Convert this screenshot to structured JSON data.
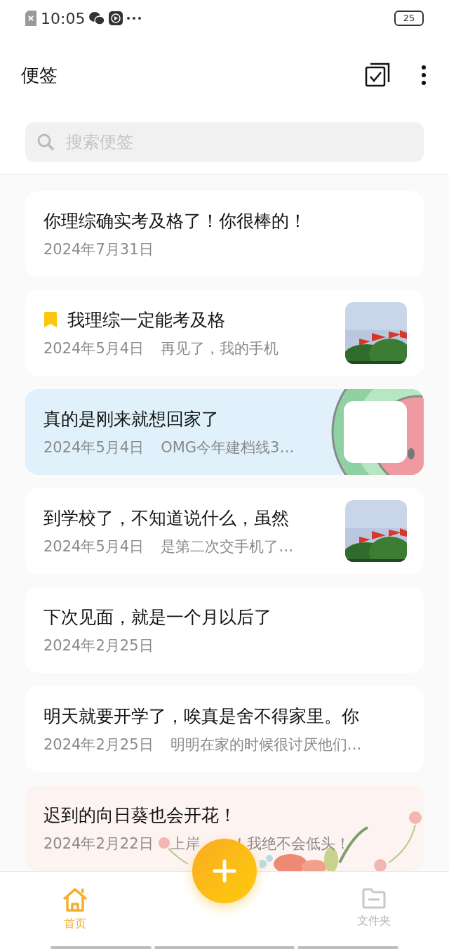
{
  "status_bar": {
    "time": "10:05",
    "battery": "25"
  },
  "header": {
    "title": "便签"
  },
  "search": {
    "placeholder": "搜索便签"
  },
  "notes": [
    {
      "kind": "plain",
      "pinned": false,
      "title": "你理综确实考及格了！你很棒的！",
      "date": "2024年7月31日"
    },
    {
      "pinned": true,
      "title": "我理综一定能考及格",
      "date": "2024年5月4日",
      "preview": "再见了，我的手机"
    },
    {
      "kind": "watermelon",
      "pinned": false,
      "title": "真的是刚来就想回家了",
      "date": "2024年5月4日",
      "preview": "OMG今年建档线3…"
    },
    {
      "pinned": false,
      "title": "到学校了，不知道说什么，虽然",
      "date": "2024年5月4日",
      "preview": "是第二次交手机了…"
    },
    {
      "kind": "plain",
      "pinned": false,
      "title": "下次见面，就是一个月以后了",
      "date": "2024年2月25日"
    },
    {
      "kind": "plain",
      "pinned": false,
      "title": "明天就要开学了，唉真是舍不得家里。你",
      "date": "2024年2月25日",
      "preview": "明明在家的时候很讨厌他们…"
    },
    {
      "kind": "floral",
      "pinned": false,
      "title": "迟到的向日葵也会开花！",
      "date": "2024年2月22日",
      "preview": "上岸",
      "preview_2": "！我绝不会低头！"
    }
  ],
  "nav": [
    {
      "label": "首页",
      "selected": true
    },
    {
      "label": "文件夹",
      "selected": false
    }
  ]
}
